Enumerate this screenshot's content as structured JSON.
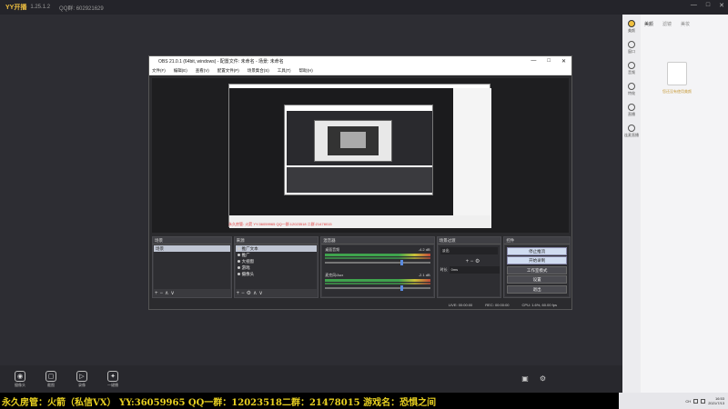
{
  "app": {
    "logo": "YY开播",
    "version": "1.25.1.2",
    "qq_group": "QQ群: 602921629"
  },
  "window_controls": [
    "—",
    "□",
    "✕"
  ],
  "obs": {
    "title": "OBS 21.0.1 (64bit, windows) - 配置文件: 未命名 - 场景: 未命名",
    "menu": [
      "文件(F)",
      "编辑(E)",
      "查看(V)",
      "配置文件(P)",
      "场景集合(S)",
      "工具(T)",
      "帮助(H)"
    ],
    "overlay_text": "永久房管: 火箭 YY:36059965 QQ一群:12023518 二群:21478015",
    "docks": {
      "scenes": {
        "title": "场景",
        "items": [
          "场景"
        ]
      },
      "sources": {
        "title": "来源",
        "items": [
          "推广文本",
          "推广",
          "大视窗",
          "游戏",
          "摄像头"
        ]
      },
      "mixer": {
        "title": "混音器",
        "rows": [
          {
            "name": "桌面音频",
            "db": "-4.2 dB"
          },
          {
            "name": "麦克风/Aux",
            "db": "-2.1 dB"
          }
        ],
        "levels": [
          0.72,
          0.72
        ]
      },
      "transitions": {
        "title": "场景过渡",
        "type": "淡出",
        "duration_label": "时长",
        "duration": "0ms"
      },
      "controls": {
        "title": "控件",
        "buttons": [
          "停止推流",
          "开始录制",
          "工作室模式",
          "设置",
          "退出"
        ]
      }
    },
    "status": {
      "live": "LIVE: 00:00:00",
      "rec": "REC: 00:00:00",
      "cpu": "CPU: 1.6%, 60.00 fps"
    }
  },
  "bottom_bar": [
    "摄像头",
    "截图",
    "录像",
    "一键播"
  ],
  "right_panel": {
    "nav": [
      "美颜",
      "窗口",
      "音频",
      "特效",
      "直播",
      "连麦直播"
    ],
    "tabs": [
      "美颜",
      "滤镜",
      "美妆"
    ],
    "empty_text": "您还没有使用美颜"
  },
  "banner": "永久房管：火箭（私信VX） YY:36059965 QQ一群：12023518二群：21478015 游戏名：恐惧之间",
  "taskbar": {
    "lang": "CH",
    "time": "16:53",
    "date": "2021/7/13"
  }
}
